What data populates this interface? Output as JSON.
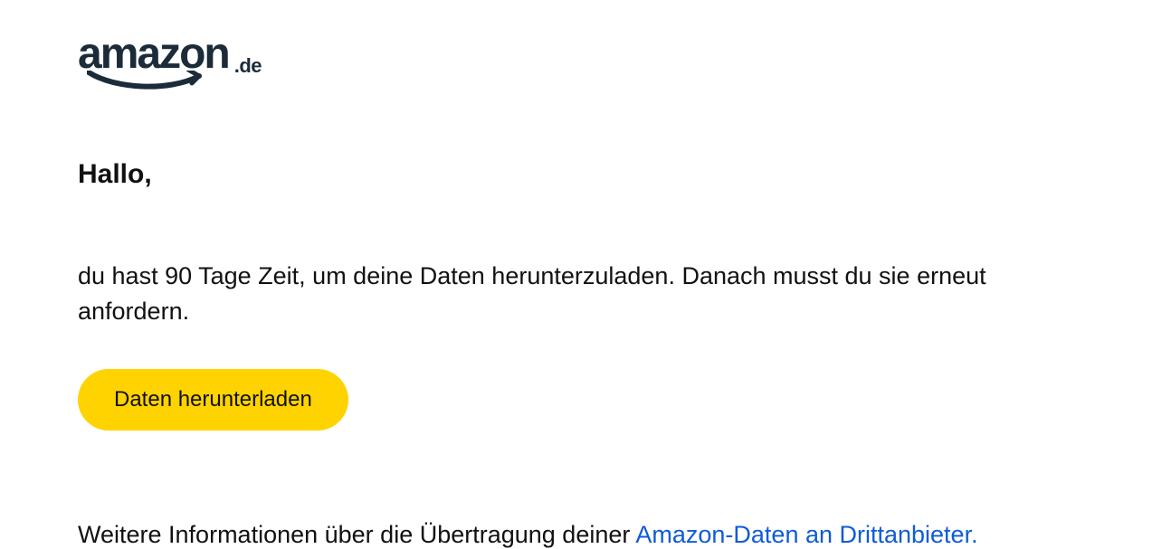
{
  "logo": {
    "brand": "amazon",
    "tld": ".de"
  },
  "greeting": "Hallo,",
  "body": "du hast 90 Tage Zeit, um deine Daten herunterzuladen. Danach musst du sie erneut anfordern.",
  "cta": {
    "label": "Daten herunterladen"
  },
  "footer": {
    "prefix": "Weitere Informationen über die Übertragung deiner ",
    "link_text": "Amazon-Daten an Drittanbieter."
  }
}
